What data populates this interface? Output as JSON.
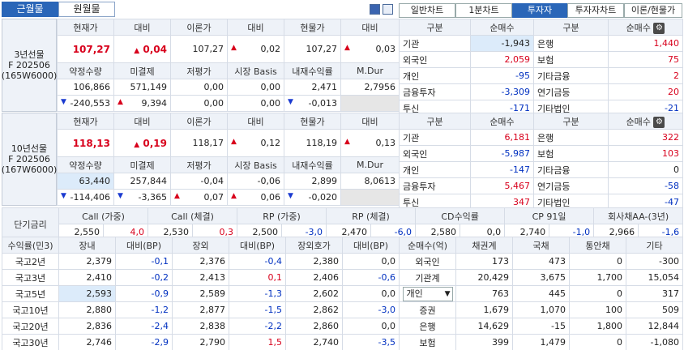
{
  "tabs": {
    "main": [
      "근월물",
      "원월물"
    ],
    "right": [
      "일반차트",
      "1분차트",
      "투자자",
      "투자자차트",
      "이론/현물가"
    ]
  },
  "fut3": {
    "name": "3년선물",
    "code": "F 202506",
    "sub": "(165W6000)",
    "h1": [
      "현재가",
      "대비",
      "이론가",
      "대비",
      "현물가",
      "대비"
    ],
    "r1": [
      "107,27",
      "0,04",
      "107,27",
      "0,02",
      "107,27",
      "0,03"
    ],
    "h2": [
      "약정수량",
      "미결제",
      "저평가",
      "시장 Basis",
      "내재수익률",
      "M.Dur"
    ],
    "r2": [
      "106,866",
      "571,149",
      "0,00",
      "0,00",
      "2,471",
      "2,7956"
    ],
    "r3": [
      "-240,553",
      "9,394",
      "0,00",
      "0,00",
      "-0,013",
      ""
    ]
  },
  "fut10": {
    "name": "10년선물",
    "code": "F 202506",
    "sub": "(167W6000)",
    "h1": [
      "현재가",
      "대비",
      "이론가",
      "대비",
      "현물가",
      "대비"
    ],
    "r1": [
      "118,13",
      "0,19",
      "118,17",
      "0,12",
      "118,19",
      "0,13"
    ],
    "h2": [
      "약정수량",
      "미결제",
      "저평가",
      "시장 Basis",
      "내재수익률",
      "M.Dur"
    ],
    "r2": [
      "63,440",
      "257,844",
      "-0,04",
      "-0,06",
      "2,899",
      "8,0613"
    ],
    "r3": [
      "-114,406",
      "-3,365",
      "0,07",
      "0,06",
      "-0,020",
      ""
    ]
  },
  "inv3": {
    "hdr": [
      "구분",
      "순매수",
      "구분",
      "순매수"
    ],
    "rows": [
      [
        "기관",
        "-1,943",
        "은행",
        "1,440"
      ],
      [
        "외국인",
        "2,059",
        "보험",
        "75"
      ],
      [
        "개인",
        "-95",
        "기타금융",
        "2"
      ],
      [
        "금융투자",
        "-3,309",
        "연기금등",
        "20"
      ],
      [
        "투신",
        "-171",
        "기타법인",
        "-21"
      ]
    ]
  },
  "inv10": {
    "hdr": [
      "구분",
      "순매수",
      "구분",
      "순매수"
    ],
    "rows": [
      [
        "기관",
        "6,181",
        "은행",
        "322"
      ],
      [
        "외국인",
        "-5,987",
        "보험",
        "103"
      ],
      [
        "개인",
        "-147",
        "기타금융",
        "0"
      ],
      [
        "금융투자",
        "5,467",
        "연기금등",
        "-58"
      ],
      [
        "투신",
        "347",
        "기타법인",
        "-47"
      ]
    ]
  },
  "short": {
    "label": "단기금리",
    "hdr": [
      "Call (가중)",
      "Call (체결)",
      "RP (가중)",
      "RP (체결)",
      "CD수익률",
      "CP 91일",
      "회사채AA-(3년)"
    ],
    "vals": [
      [
        "2,550",
        "4,0"
      ],
      [
        "2,530",
        "0,3"
      ],
      [
        "2,500",
        "-3,0"
      ],
      [
        "2,470",
        "-6,0"
      ],
      [
        "2,580",
        "0,0"
      ],
      [
        "2,740",
        "-1,0"
      ],
      [
        "2,966",
        "-1,6"
      ]
    ]
  },
  "yield": {
    "hdr": [
      "수익률(민3)",
      "장내",
      "대비(BP)",
      "장외",
      "대비(BP)",
      "장외호가",
      "대비(BP)"
    ],
    "rows": [
      [
        "국고2년",
        "2,379",
        "-0,1",
        "2,376",
        "-0,4",
        "2,380",
        "0,0"
      ],
      [
        "국고3년",
        "2,410",
        "-0,2",
        "2,413",
        "0,1",
        "2,406",
        "-0,6"
      ],
      [
        "국고5년",
        "2,593",
        "-0,9",
        "2,589",
        "-1,3",
        "2,602",
        "0,0"
      ],
      [
        "국고10년",
        "2,880",
        "-1,2",
        "2,877",
        "-1,5",
        "2,862",
        "-3,0"
      ],
      [
        "국고20년",
        "2,836",
        "-2,4",
        "2,838",
        "-2,2",
        "2,860",
        "0,0"
      ],
      [
        "국고30년",
        "2,746",
        "-2,9",
        "2,790",
        "1,5",
        "2,740",
        "-3,5"
      ]
    ]
  },
  "bond": {
    "hdr": [
      "순매수(억)",
      "채권계",
      "국채",
      "통안채",
      "기타"
    ],
    "rows": [
      [
        "외국인",
        "173",
        "473",
        "0",
        "-300"
      ],
      [
        "기관계",
        "20,429",
        "3,675",
        "1,700",
        "15,054"
      ],
      [
        "개인",
        "763",
        "445",
        "0",
        "317"
      ],
      [
        "증권",
        "1,679",
        "1,070",
        "100",
        "509"
      ],
      [
        "은행",
        "14,629",
        "-15",
        "1,800",
        "12,844"
      ],
      [
        "보험",
        "399",
        "1,479",
        "0",
        "-1,080"
      ]
    ]
  }
}
